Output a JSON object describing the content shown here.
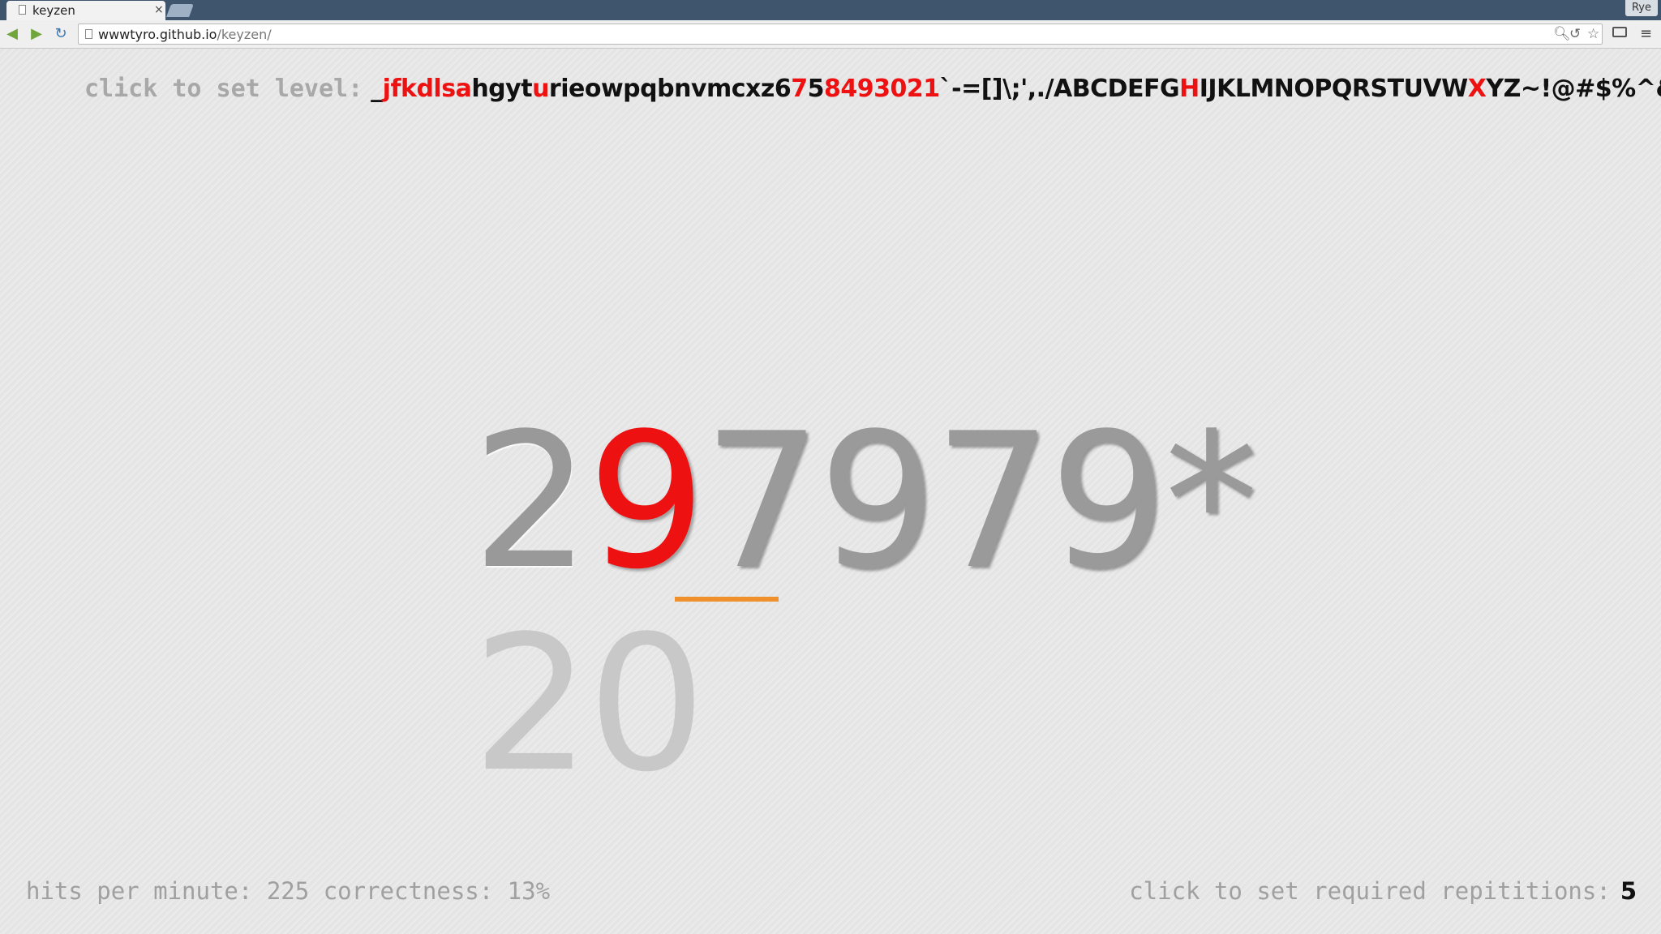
{
  "browser": {
    "tab_title": "keyzen",
    "tab_close": "×",
    "profile_name": "Rye",
    "url_host": "wwwtyro.github.io",
    "url_path": "/keyzen/",
    "icons": [
      "back-arrow-icon",
      "forward-arrow-icon",
      "reload-icon",
      "page-icon",
      "zoom-icon",
      "history-icon",
      "star-icon",
      "cast-icon",
      "menu-icon"
    ]
  },
  "level": {
    "label": "click to set level:",
    "chars_segments": [
      {
        "text": "_",
        "active": false
      },
      {
        "text": "jfkdlsa",
        "active": true
      },
      {
        "text": "hgyt",
        "active": false
      },
      {
        "text": "u",
        "active": true
      },
      {
        "text": "rieowpqbnvmcxz6",
        "active": false
      },
      {
        "text": "7",
        "active": true
      },
      {
        "text": "5",
        "active": false
      },
      {
        "text": "8493021",
        "active": true
      },
      {
        "text": "`-=[]\\;',./ABCDEFG",
        "active": false
      },
      {
        "text": "H",
        "active": true
      },
      {
        "text": "IJKLMNOPQRSTUVW",
        "active": false
      },
      {
        "text": "X",
        "active": true
      },
      {
        "text": "YZ~!@#$%^&*()_+",
        "active": false
      },
      {
        "text": "{",
        "active": true
      },
      {
        "text": "}|:\"<>",
        "active": false
      },
      {
        "text": "?",
        "active": true
      }
    ]
  },
  "word": {
    "chars": [
      {
        "char": "2",
        "state": "typed"
      },
      {
        "char": "9",
        "state": "wrong"
      },
      {
        "char": "7",
        "state": "pending"
      },
      {
        "char": "9",
        "state": "pending"
      },
      {
        "char": "7",
        "state": "pending"
      },
      {
        "char": "9",
        "state": "pending"
      },
      {
        "char": "*",
        "state": "pending"
      }
    ],
    "next_word": "20"
  },
  "stats": {
    "hits_label": "hits per minute:",
    "hits_value": "225",
    "correctness_label": "correctness:",
    "correctness_value": "13%"
  },
  "repetitions": {
    "label": "click to set required repititions:",
    "value": "5"
  },
  "colors": {
    "accent_red": "#ee1111",
    "cursor_orange": "#f0902a",
    "chrome_blue": "#3e556d"
  }
}
